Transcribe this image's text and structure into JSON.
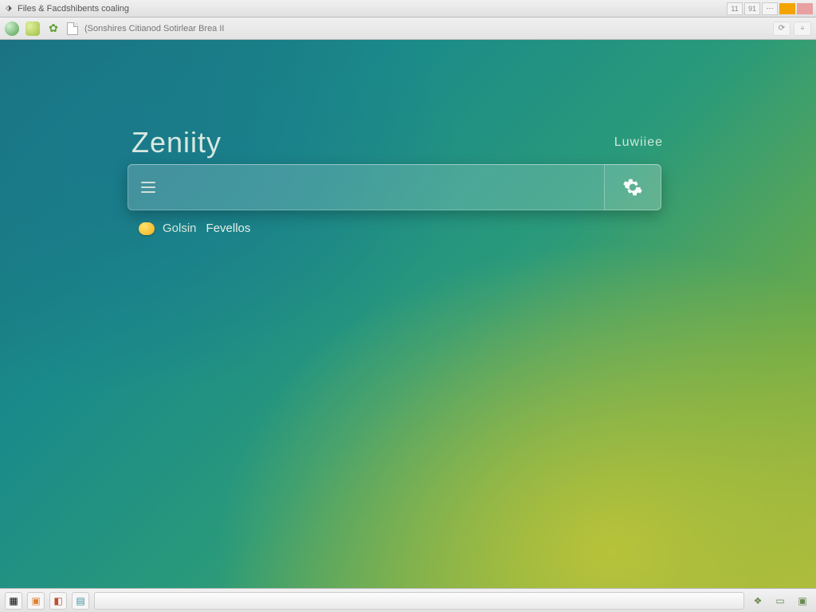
{
  "titlebar": {
    "title": "Files & Facdshibents coaling",
    "tray_labels": [
      "11",
      "91"
    ]
  },
  "toolbar": {
    "location": "(Sonshires Citianod Sotirlear Brea II"
  },
  "brand": "Zeniity",
  "right_link": "Luwiiee",
  "search": {
    "placeholder": ""
  },
  "chip": {
    "label_a": "Golsin",
    "label_b": "Fevellos"
  },
  "icons": {
    "globe": "globe-icon",
    "app": "app-icon",
    "leaf": "leaf-icon",
    "page": "page-icon",
    "hamburger": "menu-icon",
    "gear": "gear-icon"
  }
}
